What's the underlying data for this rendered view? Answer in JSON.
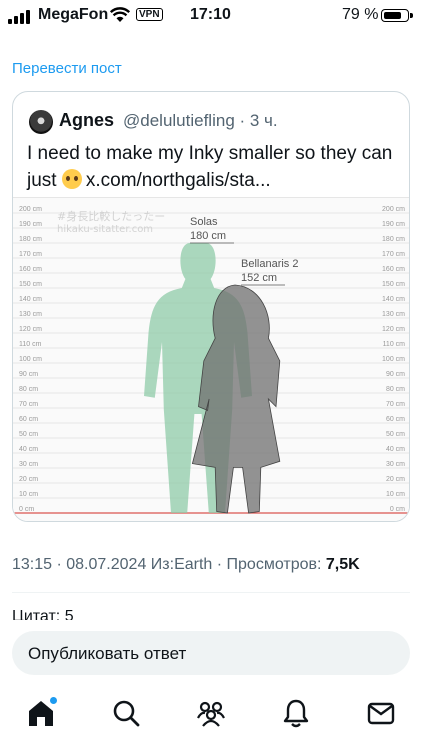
{
  "status_bar": {
    "carrier": "MegaFon",
    "vpn": "VPN",
    "time": "17:10",
    "battery": "79 %",
    "battery_level": 0.79
  },
  "translate_link": "Перевести пост",
  "quote": {
    "name": "Agnes",
    "handle": "@delulutiefling · 3 ч.",
    "text_before_emoji": "I need to make my Inky smaller so they can just",
    "text_after_emoji": "x.com/northgalis/sta..."
  },
  "chart_data": {
    "type": "height-comparison",
    "watermark_line1": "#身長比較したったー",
    "watermark_line2": "hikaku-sitatter.com",
    "y_ticks": [
      "200 cm",
      "190 cm",
      "180 cm",
      "170 cm",
      "160 cm",
      "150 cm",
      "140 cm",
      "130 cm",
      "120 cm",
      "110 cm",
      "100 cm",
      "90 cm",
      "80 cm",
      "70 cm",
      "60 cm",
      "50 cm",
      "40 cm",
      "30 cm",
      "20 cm",
      "10 cm",
      "0 cm"
    ],
    "ylim": [
      0,
      200
    ],
    "figures": [
      {
        "name": "Solas",
        "height_label": "180 cm",
        "height": 180,
        "color": "#8fcba8"
      },
      {
        "name": "Bellanaris 2",
        "height_label": "152 cm",
        "height": 152,
        "color": "#6f6f6f"
      }
    ]
  },
  "meta": {
    "time_date": "13:15 · 08.07.2024 Из:Earth · Просмотров:",
    "views": "7,5K"
  },
  "quotes_label": "Цитат: 5",
  "reply_placeholder": "Опубликовать ответ",
  "nav": {
    "icons": [
      "home-icon",
      "search-icon",
      "communities-icon",
      "notifications-icon",
      "messages-icon"
    ]
  }
}
